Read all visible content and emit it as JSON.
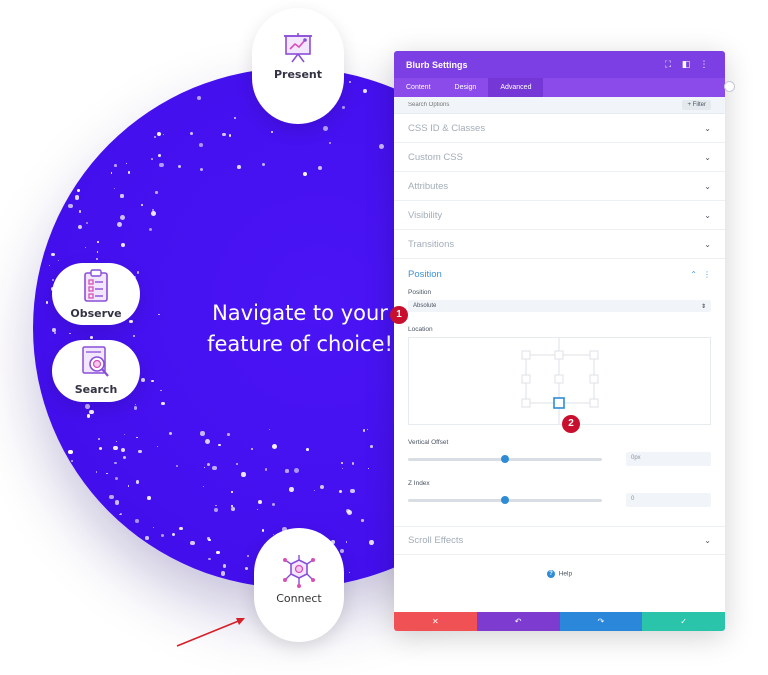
{
  "scene": {
    "headline_lines": [
      "Navigate to your",
      "feature of choice!"
    ],
    "features": {
      "present": "Present",
      "observe": "Observe",
      "search": "Search",
      "connect": "Connect"
    },
    "brand_color": "#4410ee"
  },
  "panel": {
    "title": "Blurb Settings",
    "header_icons": [
      "expand-icon",
      "split-view-icon",
      "more-options-icon"
    ],
    "tabs": [
      {
        "label": "Content",
        "active": false
      },
      {
        "label": "Design",
        "active": false
      },
      {
        "label": "Advanced",
        "active": true
      }
    ],
    "search_placeholder": "Search Options",
    "filter_label": "+ Filter",
    "sections": {
      "css_id": "CSS ID & Classes",
      "custom_css": "Custom CSS",
      "attributes": "Attributes",
      "visibility": "Visibility",
      "transitions": "Transitions",
      "scroll_effects": "Scroll Effects"
    },
    "position": {
      "title": "Position",
      "position_label": "Position",
      "position_value": "Absolute",
      "location_label": "Location",
      "vertical_offset_label": "Vertical Offset",
      "vertical_offset_value": "0px",
      "vertical_offset_level": 0.5,
      "z_index_label": "Z Index",
      "z_index_value": "0",
      "z_index_level": 0.5
    },
    "help_label": "Help",
    "footer_buttons": [
      {
        "name": "discard-button",
        "glyph": "✕",
        "color": "#ef5155"
      },
      {
        "name": "undo-button",
        "glyph": "↶",
        "color": "#7e3bd0"
      },
      {
        "name": "redo-button",
        "glyph": "↷",
        "color": "#2b87da"
      },
      {
        "name": "save-button",
        "glyph": "✓",
        "color": "#29c4a9"
      }
    ],
    "accent_color": "#7b3fe4"
  },
  "annotations": {
    "badge_1": "1",
    "badge_2": "2"
  }
}
